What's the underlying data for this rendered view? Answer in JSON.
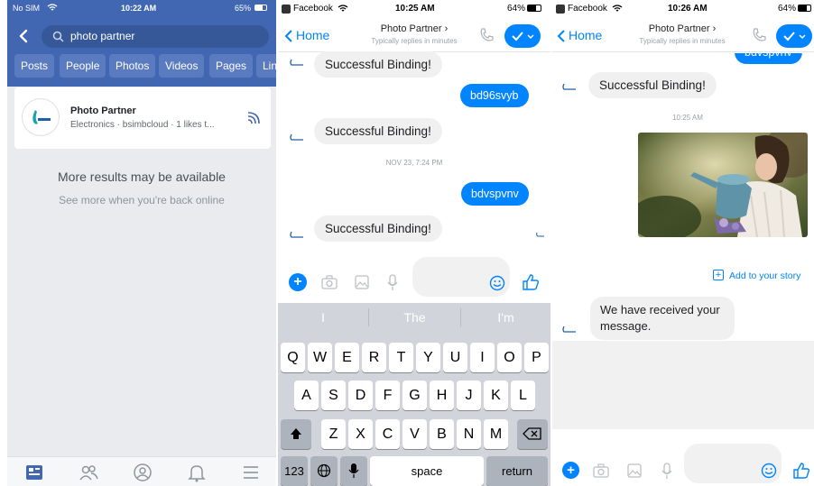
{
  "search_screen": {
    "status": {
      "carrier": "No SIM",
      "time": "10:22 AM",
      "battery": "65%"
    },
    "search": {
      "value": "photo partner"
    },
    "filters": [
      "Posts",
      "People",
      "Photos",
      "Videos",
      "Pages",
      "Link"
    ],
    "result": {
      "name": "Photo Partner",
      "subtitle": "Electronics · bsimbcloud · 1 likes t..."
    },
    "offline": {
      "title": "More results may be available",
      "subtitle": "See more when you're back online"
    },
    "nav": [
      "news-feed",
      "friends",
      "profile",
      "notifications",
      "menu"
    ]
  },
  "chat_keyboard": {
    "status": {
      "carrier": "Facebook",
      "time": "10:25 AM",
      "battery": "64%"
    },
    "header": {
      "back": "Home",
      "title": "Photo Partner",
      "subtitle": "Typically replies in minutes"
    },
    "messages": [
      {
        "from": "bot",
        "text": "Successful Binding!"
      },
      {
        "from": "me",
        "text": "bd96svyb"
      },
      {
        "from": "bot",
        "text": "Successful Binding!"
      },
      {
        "type": "timestamp",
        "text": "NOV 23, 7:24 PM"
      },
      {
        "from": "me",
        "text": "bdvspvnv"
      },
      {
        "from": "bot",
        "text": "Successful Binding!"
      }
    ],
    "suggestions": [
      "I",
      "The",
      "I'm"
    ],
    "keyboard": {
      "row1": [
        "Q",
        "W",
        "E",
        "R",
        "T",
        "Y",
        "U",
        "I",
        "O",
        "P"
      ],
      "row2": [
        "A",
        "S",
        "D",
        "F",
        "G",
        "H",
        "J",
        "K",
        "L"
      ],
      "row3": [
        "Z",
        "X",
        "C",
        "V",
        "B",
        "N",
        "M"
      ],
      "numbers": "123",
      "space": "space",
      "return": "return"
    }
  },
  "chat_image": {
    "status": {
      "carrier": "Facebook",
      "time": "10:26 AM",
      "battery": "64%"
    },
    "header": {
      "back": "Home",
      "title": "Photo Partner",
      "subtitle": "Typically replies in minutes"
    },
    "messages": [
      {
        "from": "me",
        "text": "bdvspvnv"
      },
      {
        "from": "bot",
        "text": "Successful Binding!"
      },
      {
        "type": "timestamp",
        "text": "10:25 AM"
      },
      {
        "type": "image",
        "subject": "child with watering can"
      },
      {
        "type": "action",
        "text": "Add to your story"
      },
      {
        "from": "bot",
        "line1": "We have received your",
        "line2": "message."
      }
    ]
  },
  "colors": {
    "facebook_blue": "#4267b2",
    "messenger_blue": "#0084ff",
    "bubble_grey": "#f1f0f0"
  }
}
